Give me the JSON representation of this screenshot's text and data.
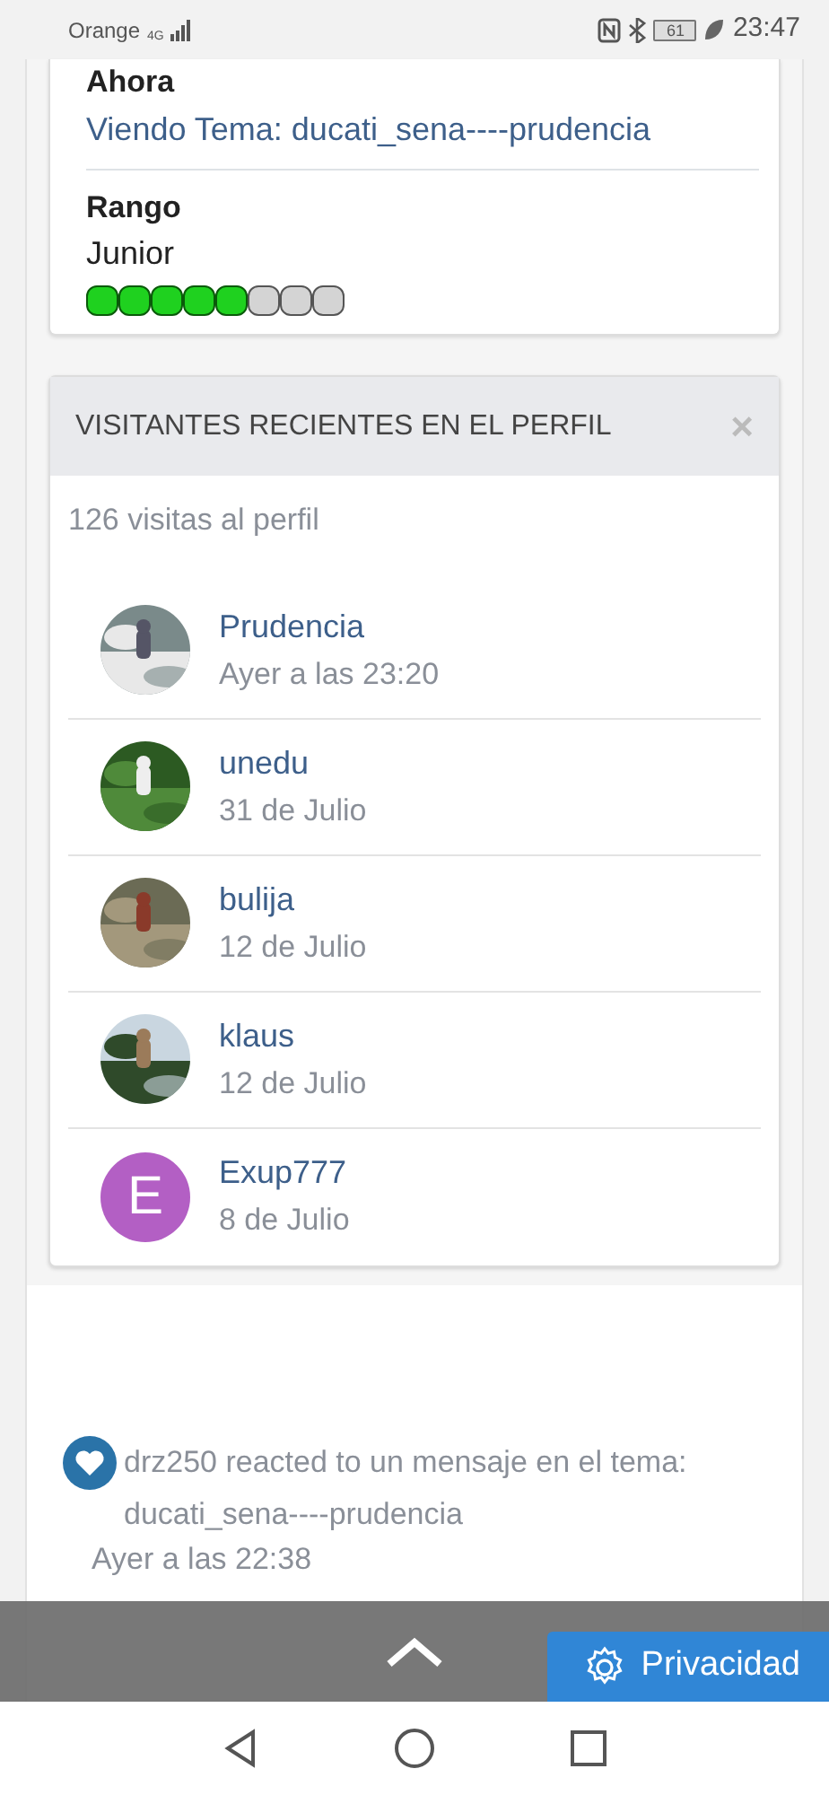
{
  "status_bar": {
    "carrier": "Orange",
    "network": "4G",
    "battery": "61",
    "time": "23:47"
  },
  "profile_info": {
    "now_label": "Ahora",
    "now_value": "Viendo Tema: ducati_sena----prudencia",
    "rank_label": "Rango",
    "rank_value": "Junior",
    "stars": 5
  },
  "visitors_panel": {
    "title": "VISITANTES RECIENTES EN EL PERFIL",
    "close": "×",
    "count": "126 visitas al perfil",
    "visitors": [
      {
        "name": "Prudencia",
        "time": "Ayer a las 23:20"
      },
      {
        "name": "unedu",
        "time": "31 de Julio"
      },
      {
        "name": "bulija",
        "time": "12 de Julio"
      },
      {
        "name": "klaus",
        "time": "12 de Julio"
      },
      {
        "name": "Exup777",
        "time": "8 de Julio",
        "avatar": {
          "kind": "letter",
          "letter": "E",
          "color": "#b35fc4"
        }
      }
    ]
  },
  "activity": {
    "text": "drz250 reacted to un mensaje en el tema: ducati_sena----prudencia",
    "time": "Ayer a las 22:38"
  },
  "bottom_bar": {
    "privacy_button": "Privacidad"
  }
}
